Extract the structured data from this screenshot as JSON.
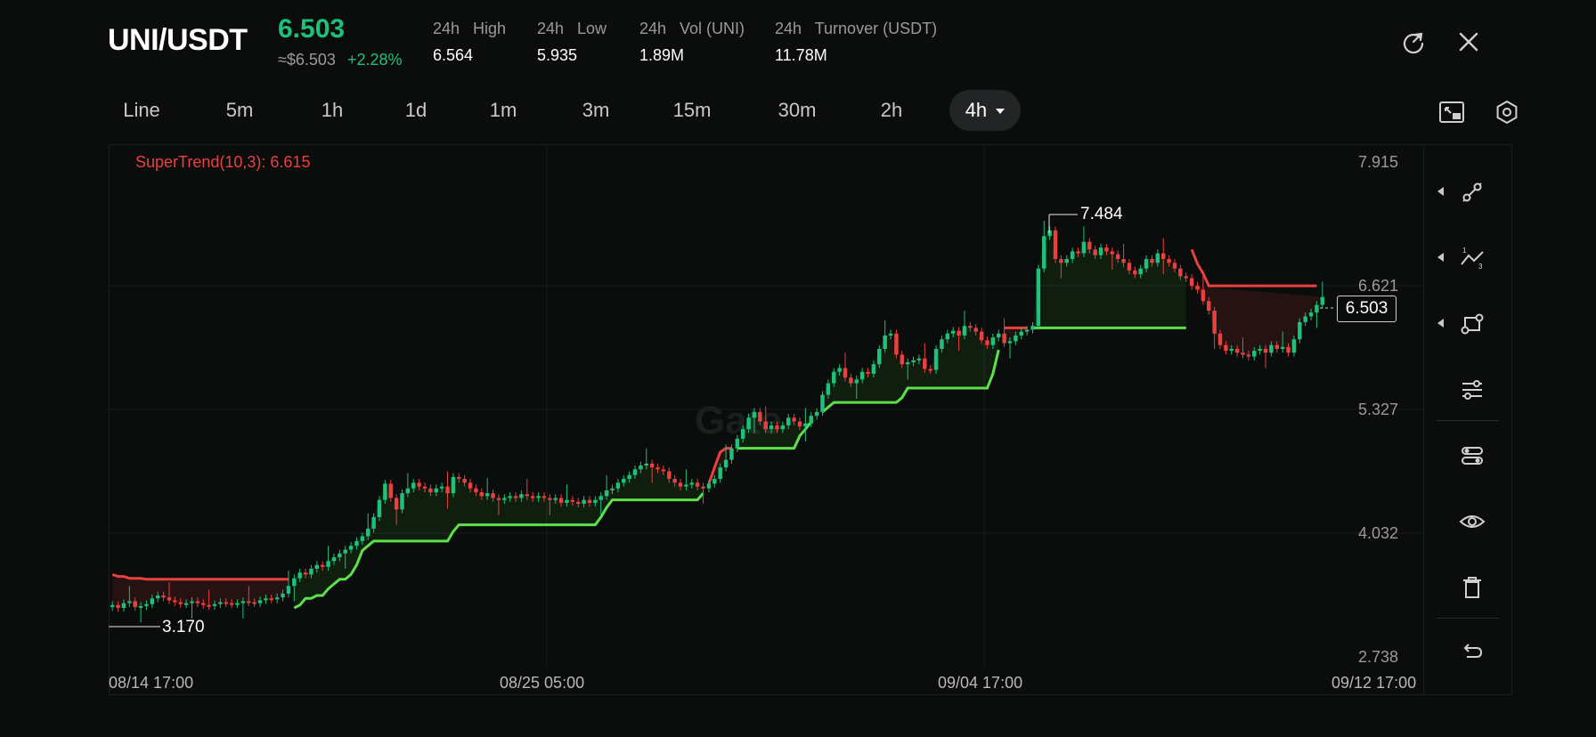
{
  "header": {
    "pair": "UNI/USDT",
    "price": "6.503",
    "usd_price": "≈$6.503",
    "change": "+2.28%",
    "stats": [
      {
        "label": "24h   High",
        "value": "6.564"
      },
      {
        "label": "24h   Low",
        "value": "5.935"
      },
      {
        "label": "24h   Vol (UNI)",
        "value": "1.89M"
      },
      {
        "label": "24h   Turnover (USDT)",
        "value": "11.78M"
      }
    ],
    "icons": [
      "refresh-icon",
      "close-icon"
    ]
  },
  "tabs": {
    "items": [
      "Line",
      "5m",
      "1h",
      "1d",
      "1m",
      "3m",
      "15m",
      "30m",
      "2h",
      "4h"
    ],
    "active": "4h",
    "icons": [
      "fullscreen-icon",
      "settings-icon"
    ]
  },
  "chart": {
    "indicator_legend": "SuperTrend(10,3): 6.615",
    "watermark": "Gate",
    "high_label": "7.484",
    "low_label": "3.170",
    "current_price_label": "6.503",
    "colors": {
      "up": "#1fc07a",
      "down": "#e8413e",
      "supertrend_up": "#5ee04a",
      "supertrend_down": "#e8413e"
    }
  },
  "chart_data": {
    "type": "candlestick",
    "title": "",
    "x_ticks": [
      "08/14 17:00",
      "08/25 05:00",
      "09/04 17:00",
      "09/12 17:00"
    ],
    "y_ticks": [
      "7.915",
      "6.621",
      "5.327",
      "4.032",
      "2.738"
    ],
    "ylim": [
      2.738,
      7.915
    ],
    "grid": true,
    "series": [
      {
        "name": "SuperTrend(10,3)",
        "last": 6.615
      },
      {
        "name": "UNI/USDT",
        "last": 6.503,
        "high_marker": 7.484,
        "low_marker": 3.17
      }
    ],
    "closes": [
      3.28,
      3.25,
      3.3,
      3.32,
      3.26,
      3.27,
      3.29,
      3.35,
      3.38,
      3.36,
      3.33,
      3.31,
      3.29,
      3.3,
      3.32,
      3.3,
      3.28,
      3.27,
      3.29,
      3.31,
      3.3,
      3.29,
      3.3,
      3.32,
      3.31,
      3.3,
      3.33,
      3.35,
      3.34,
      3.36,
      3.4,
      3.48,
      3.56,
      3.62,
      3.6,
      3.66,
      3.7,
      3.68,
      3.74,
      3.78,
      3.82,
      3.86,
      3.9,
      3.95,
      4.0,
      4.08,
      4.2,
      4.38,
      4.55,
      4.4,
      4.28,
      4.45,
      4.5,
      4.56,
      4.52,
      4.5,
      4.46,
      4.5,
      4.52,
      4.45,
      4.62,
      4.6,
      4.56,
      4.5,
      4.46,
      4.42,
      4.45,
      4.4,
      4.38,
      4.4,
      4.42,
      4.4,
      4.44,
      4.42,
      4.4,
      4.42,
      4.4,
      4.38,
      4.4,
      4.35,
      4.38,
      4.36,
      4.34,
      4.38,
      4.35,
      4.38,
      4.42,
      4.48,
      4.5,
      4.56,
      4.6,
      4.64,
      4.7,
      4.74,
      4.76,
      4.72,
      4.7,
      4.68,
      4.6,
      4.56,
      4.52,
      4.54,
      4.56,
      4.52,
      4.5,
      4.55,
      4.6,
      4.72,
      4.8,
      4.92,
      5.02,
      5.12,
      5.24,
      5.3,
      5.2,
      5.12,
      5.16,
      5.12,
      5.16,
      5.24,
      5.2,
      5.15,
      5.18,
      5.26,
      5.3,
      5.48,
      5.6,
      5.72,
      5.76,
      5.66,
      5.6,
      5.64,
      5.72,
      5.7,
      5.8,
      5.96,
      6.1,
      6.12,
      5.9,
      5.8,
      5.82,
      5.84,
      5.86,
      5.75,
      5.74,
      5.96,
      6.06,
      6.12,
      6.15,
      6.1,
      6.2,
      6.18,
      6.14,
      6.05,
      6.0,
      6.08,
      6.12,
      6.02,
      6.04,
      6.1,
      6.14,
      6.16,
      6.2,
      6.8,
      7.14,
      7.2,
      6.9,
      6.86,
      6.9,
      6.98,
      6.96,
      7.08,
      7.0,
      6.94,
      7.02,
      6.98,
      6.95,
      6.9,
      6.86,
      6.78,
      6.74,
      6.8,
      6.9,
      6.86,
      6.96,
      6.9,
      6.86,
      6.8,
      6.72,
      6.7,
      6.62,
      6.58,
      6.46,
      6.36,
      6.12,
      6.0,
      5.94,
      5.96,
      5.92,
      5.9,
      5.88,
      5.94,
      5.96,
      5.92,
      6.0,
      5.96,
      5.98,
      5.92,
      6.06,
      6.24,
      6.3,
      6.34,
      6.42,
      6.503
    ],
    "supertrend": [
      3.6,
      3.58,
      3.58,
      3.56,
      3.56,
      3.56,
      3.55,
      3.55,
      3.55,
      3.55,
      3.55,
      3.55,
      3.55,
      3.55,
      3.55,
      3.55,
      3.55,
      3.55,
      3.55,
      3.55,
      3.55,
      3.55,
      3.55,
      3.55,
      3.55,
      3.55,
      3.55,
      3.55,
      3.55,
      3.55,
      3.55,
      3.55,
      3.25,
      3.28,
      3.35,
      3.35,
      3.38,
      3.38,
      3.45,
      3.5,
      3.55,
      3.55,
      3.6,
      3.7,
      3.85,
      3.9,
      3.95,
      3.95,
      3.95,
      3.95,
      3.95,
      3.95,
      3.95,
      3.95,
      3.95,
      3.95,
      3.95,
      3.95,
      3.95,
      3.95,
      4.05,
      4.12,
      4.12,
      4.12,
      4.12,
      4.12,
      4.12,
      4.12,
      4.12,
      4.12,
      4.12,
      4.12,
      4.12,
      4.12,
      4.12,
      4.12,
      4.12,
      4.12,
      4.12,
      4.12,
      4.12,
      4.12,
      4.12,
      4.12,
      4.12,
      4.12,
      4.2,
      4.3,
      4.38,
      4.38,
      4.38,
      4.38,
      4.38,
      4.38,
      4.38,
      4.38,
      4.38,
      4.38,
      4.38,
      4.38,
      4.38,
      4.38,
      4.38,
      4.38,
      4.45,
      4.55,
      4.72,
      4.88,
      4.92,
      4.92,
      4.92,
      4.92,
      4.92,
      4.92,
      4.92,
      4.92,
      4.92,
      4.92,
      4.92,
      4.92,
      4.92,
      5.05,
      5.12,
      5.2,
      5.3,
      5.3,
      5.35,
      5.4,
      5.4,
      5.4,
      5.4,
      5.4,
      5.4,
      5.4,
      5.4,
      5.4,
      5.4,
      5.4,
      5.4,
      5.45,
      5.55,
      5.55,
      5.55,
      5.55,
      5.55,
      5.55,
      5.55,
      5.55,
      5.55,
      5.55,
      5.55,
      5.55,
      5.55,
      5.55,
      5.55,
      5.7,
      5.95,
      6.18,
      6.18,
      6.18,
      6.18,
      6.18,
      6.18,
      6.18,
      6.18,
      6.18,
      6.18,
      6.18,
      6.18,
      6.18,
      6.18,
      6.18,
      6.18,
      6.18,
      6.18,
      6.18,
      6.18,
      6.18,
      6.18,
      6.18,
      6.18,
      6.18,
      6.18,
      6.18,
      6.18,
      6.18,
      6.18,
      6.18,
      6.18,
      6.18,
      7.0,
      6.85,
      6.75,
      6.62,
      6.62,
      6.62,
      6.62,
      6.62,
      6.62,
      6.62,
      6.62,
      6.62,
      6.62,
      6.62,
      6.62,
      6.62,
      6.62,
      6.62,
      6.62,
      6.62,
      6.62,
      6.62,
      6.62
    ]
  }
}
